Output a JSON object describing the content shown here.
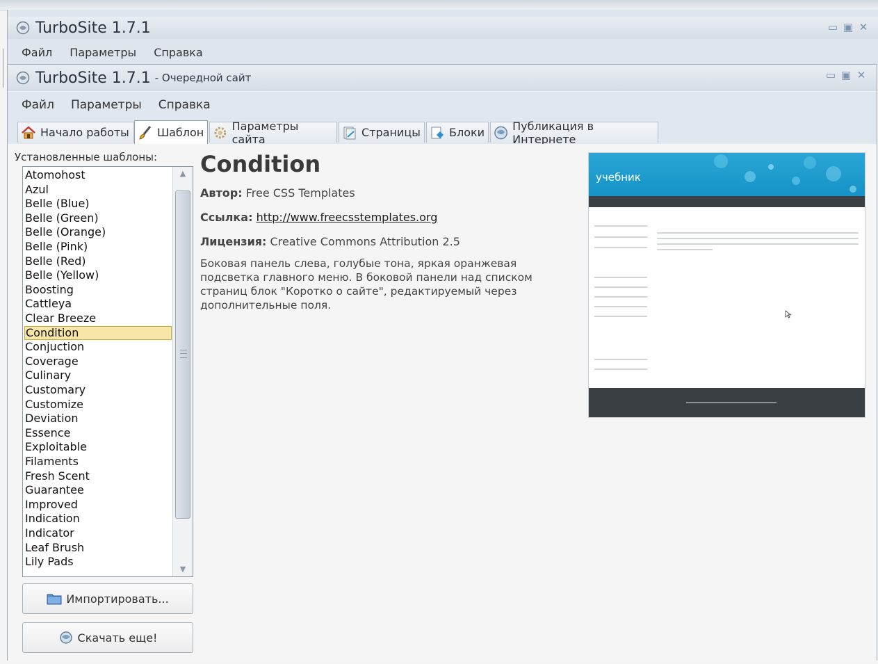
{
  "back_window": {
    "title": "TurboSite 1.7.1",
    "menu": [
      "Файл",
      "Параметры",
      "Справка"
    ]
  },
  "window": {
    "title": "TurboSite 1.7.1",
    "subtitle": "- Очередной сайт",
    "menu": [
      "Файл",
      "Параметры",
      "Справка"
    ]
  },
  "tabs": [
    {
      "label": "Начало работы",
      "icon": "home-icon"
    },
    {
      "label": "Шаблон",
      "icon": "brush-icon",
      "active": true
    },
    {
      "label": "Параметры сайта",
      "icon": "gear-icon"
    },
    {
      "label": "Страницы",
      "icon": "pages-icon"
    },
    {
      "label": "Блоки",
      "icon": "blocks-icon"
    },
    {
      "label": "Публикация в Интернете",
      "icon": "globe-icon"
    }
  ],
  "sidebar": {
    "label": "Установленные шаблоны:",
    "templates": [
      "Atomohost",
      "Azul",
      "Belle (Blue)",
      "Belle (Green)",
      "Belle (Orange)",
      "Belle (Pink)",
      "Belle (Red)",
      "Belle (Yellow)",
      "Boosting",
      "Cattleya",
      "Clear Breeze",
      "Condition",
      "Conjuction",
      "Coverage",
      "Culinary",
      "Customary",
      "Customize",
      "Deviation",
      "Essence",
      "Exploitable",
      "Filaments",
      "Fresh Scent",
      "Guarantee",
      "Improved",
      "Indication",
      "Indicator",
      "Leaf Brush",
      "Lily Pads"
    ],
    "selected": "Condition",
    "import_button": "Импортировать...",
    "download_button": "Скачать еще!"
  },
  "template": {
    "name": "Condition",
    "author_label": "Автор:",
    "author": "Free CSS Templates",
    "link_label": "Ссылка:",
    "link": "http://www.freecsstemplates.org",
    "license_label": "Лицензия:",
    "license": "Creative Commons Attribution 2.5",
    "description": "Боковая панель слева, голубые тона, яркая оранжевая подсветка главного меню. В боковой панели над списком страниц блок \"Коротко о сайте\", редактируемый через дополнительные поля."
  },
  "preview": {
    "brand": "учебник",
    "colors": {
      "header": "#1ba0d2",
      "nav": "#3a3f43",
      "footer": "#3a3f43",
      "accent": "#3bb23b"
    }
  }
}
